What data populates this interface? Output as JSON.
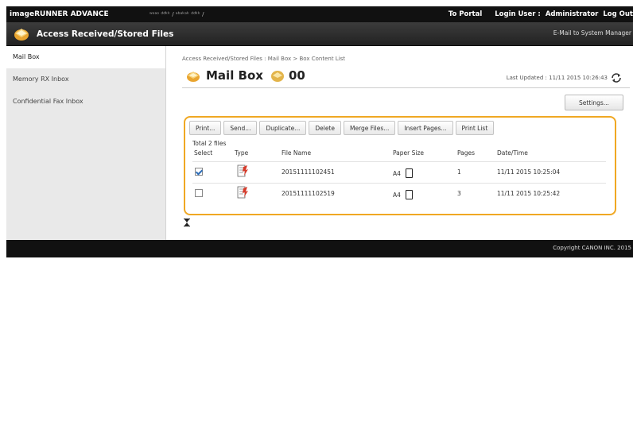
{
  "header": {
    "brand": "imageRUNNER ADVANCE",
    "device_name": "ʷᵉᵃᵒ ᵈᵈᵏᵏ / ᵃᵇᵃᵏᵃᵏ ᵈᵈᵏᵏ /",
    "to_portal": "To Portal",
    "login_label": "Login User :",
    "login_user": "Administrator",
    "logout": "Log Out"
  },
  "titlebar": {
    "title": "Access Received/Stored Files",
    "email_link": "E-Mail to System Manager"
  },
  "sidebar": {
    "items": [
      {
        "label": "Mail Box"
      },
      {
        "label": "Memory RX Inbox"
      },
      {
        "label": "Confidential Fax Inbox"
      }
    ]
  },
  "main": {
    "breadcrumb": "Access Received/Stored Files : Mail Box > Box Content List",
    "heading": "Mail Box",
    "box_number": "00",
    "last_updated": "Last Updated : 11/11 2015 10:26:43",
    "settings_button": "Settings..."
  },
  "toolbar": {
    "buttons": [
      "Print...",
      "Send...",
      "Duplicate...",
      "Delete",
      "Merge Files...",
      "Insert Pages...",
      "Print List"
    ]
  },
  "table": {
    "total": "Total 2 files",
    "headers": {
      "select": "Select",
      "type": "Type",
      "file_name": "File Name",
      "paper_size": "Paper Size",
      "pages": "Pages",
      "datetime": "Date/Time"
    },
    "rows": [
      {
        "selected": true,
        "file_name": "20151111102451",
        "paper_size": "A4",
        "pages": "1",
        "datetime": "11/11 2015 10:25:04"
      },
      {
        "selected": false,
        "file_name": "20151111102519",
        "paper_size": "A4",
        "pages": "3",
        "datetime": "11/11 2015 10:25:42"
      }
    ]
  },
  "footer": {
    "copyright": "Copyright CANON INC. 2015"
  },
  "colors": {
    "accent_border": "#f0a823",
    "link": "#1f55a8",
    "header_bg": "#111111"
  }
}
